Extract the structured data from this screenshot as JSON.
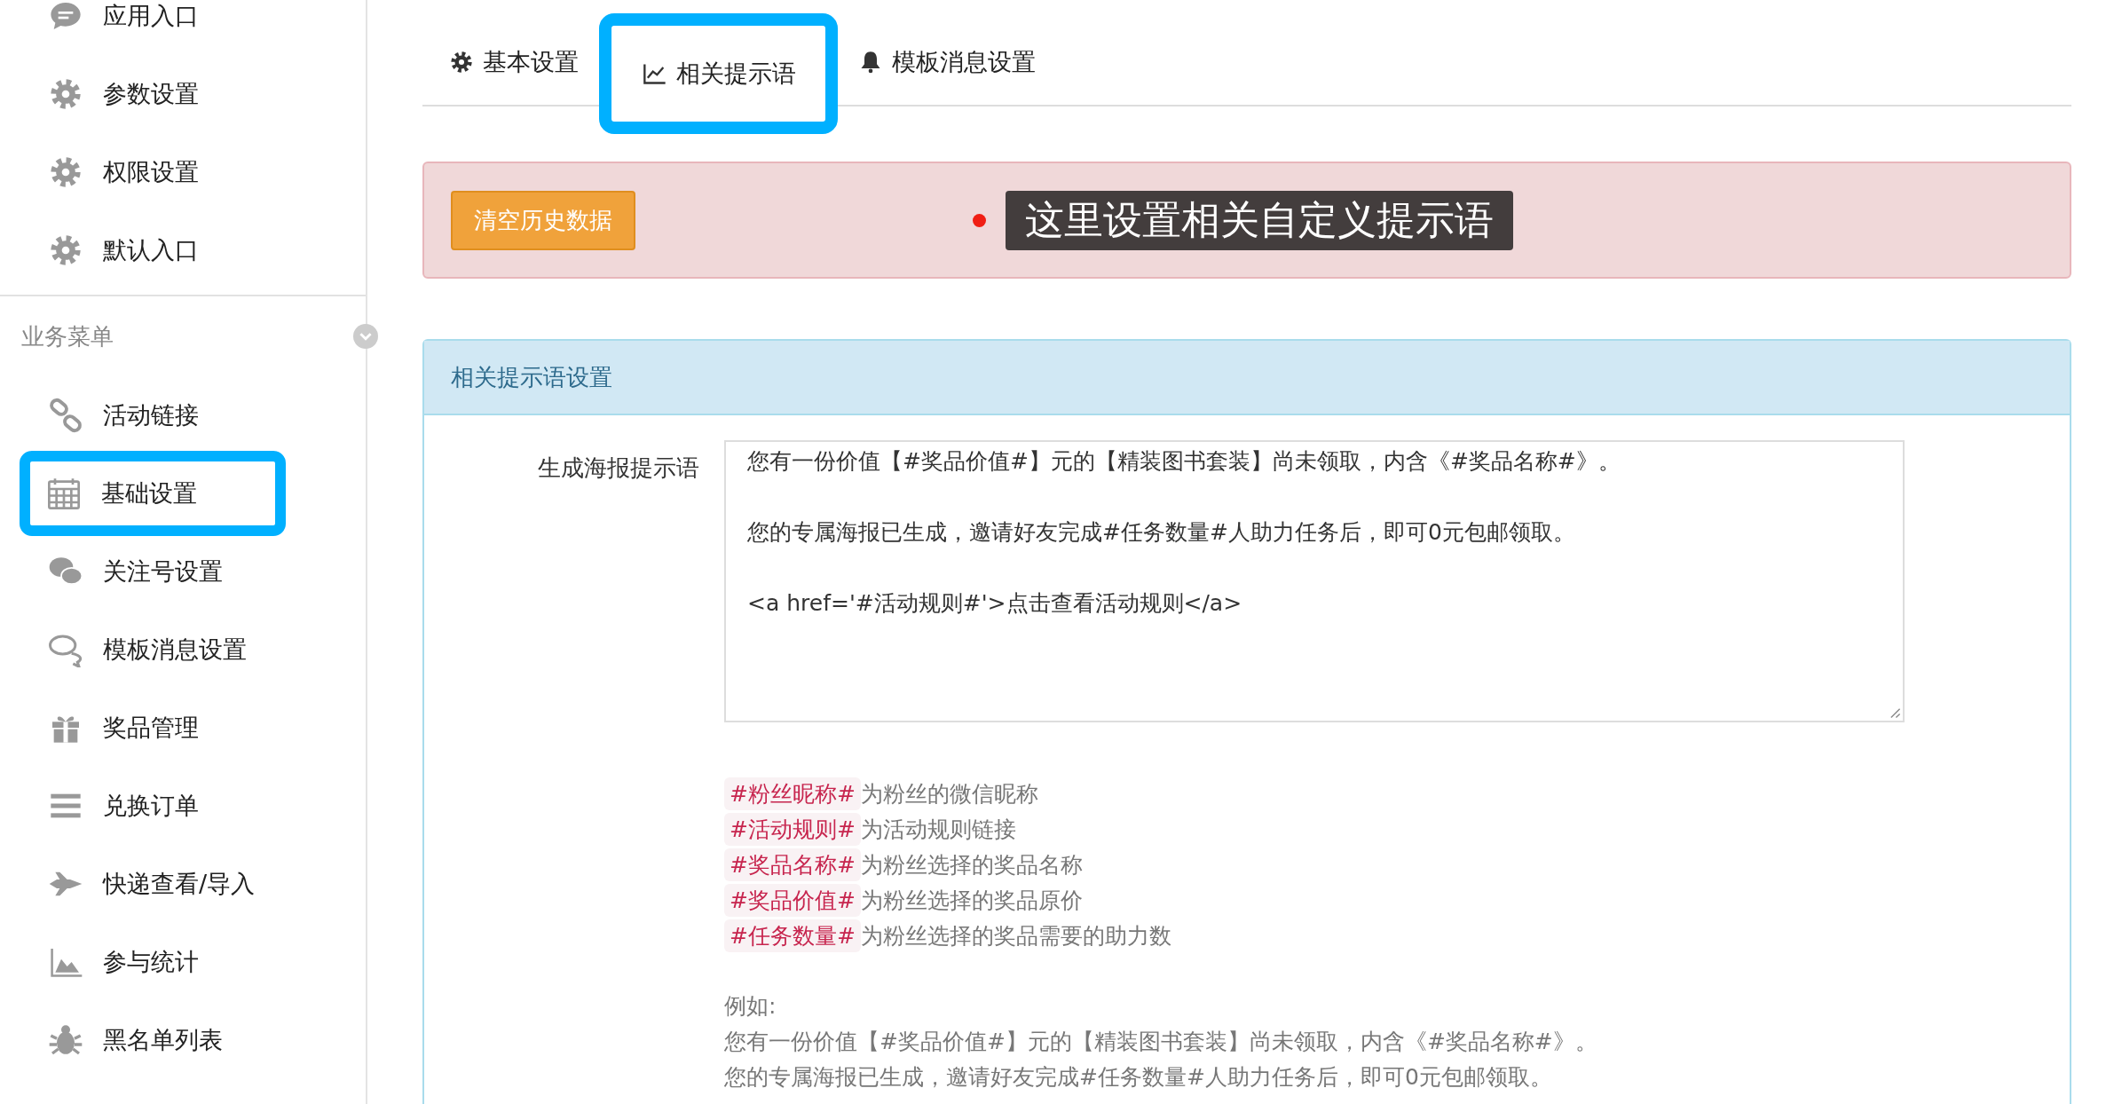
{
  "sidebar": {
    "top_items": [
      {
        "label": "应用入口",
        "kind": "chat",
        "selected": false
      },
      {
        "label": "参数设置",
        "kind": "gear",
        "selected": false
      },
      {
        "label": "权限设置",
        "kind": "gear",
        "selected": false
      },
      {
        "label": "默认入口",
        "kind": "gear",
        "selected": false
      }
    ],
    "section": {
      "title": "业务菜单",
      "expanded": true
    },
    "items": [
      {
        "label": "活动链接",
        "kind": "link",
        "selected": false
      },
      {
        "label": "基础设置",
        "kind": "calendar",
        "selected": true
      },
      {
        "label": "关注号设置",
        "kind": "wechat",
        "selected": false
      },
      {
        "label": "模板消息设置",
        "kind": "comments",
        "selected": false
      },
      {
        "label": "奖品管理",
        "kind": "gift",
        "selected": false
      },
      {
        "label": "兑换订单",
        "kind": "bars",
        "selected": false
      },
      {
        "label": "快递查看/导入",
        "kind": "plane",
        "selected": false
      },
      {
        "label": "参与统计",
        "kind": "area",
        "selected": false
      },
      {
        "label": "黑名单列表",
        "kind": "bug",
        "selected": false
      }
    ]
  },
  "tabs": [
    {
      "label": "基本设置",
      "kind": "gear",
      "selected": false
    },
    {
      "label": "相关提示语",
      "kind": "chart",
      "selected": true
    },
    {
      "label": "模板消息设置",
      "kind": "bell",
      "selected": false
    }
  ],
  "alert": {
    "button": "清空历史数据",
    "callout": "这里设置相关自定义提示语"
  },
  "panel": {
    "title": "相关提示语设置",
    "field_label": "生成海报提示语",
    "field_lines": [
      "您有一份价值【#奖品价值#】元的【精装图书套装】尚未领取，内含《#奖品名称#》。",
      "您的专属海报已生成，邀请好友完成#任务数量#人助力任务后，即可0元包邮领取。",
      "<a href='#活动规则#'>点击查看活动规则</a>"
    ],
    "variables": [
      {
        "tag": "#粉丝昵称#",
        "text": "为粉丝的微信昵称"
      },
      {
        "tag": "#活动规则#",
        "text": "为活动规则链接"
      },
      {
        "tag": "#奖品名称#",
        "text": "为粉丝选择的奖品名称"
      },
      {
        "tag": "#奖品价值#",
        "text": "为粉丝选择的奖品原价"
      },
      {
        "tag": "#任务数量#",
        "text": "为粉丝选择的奖品需要的助力数"
      }
    ],
    "example_label": "例如:",
    "example_lines": [
      "您有一份价值【#奖品价值#】元的【精装图书套装】尚未领取，内含《#奖品名称#》。",
      "您的专属海报已生成，邀请好友完成#任务数量#人助力任务后，即可0元包邮领取。"
    ]
  }
}
